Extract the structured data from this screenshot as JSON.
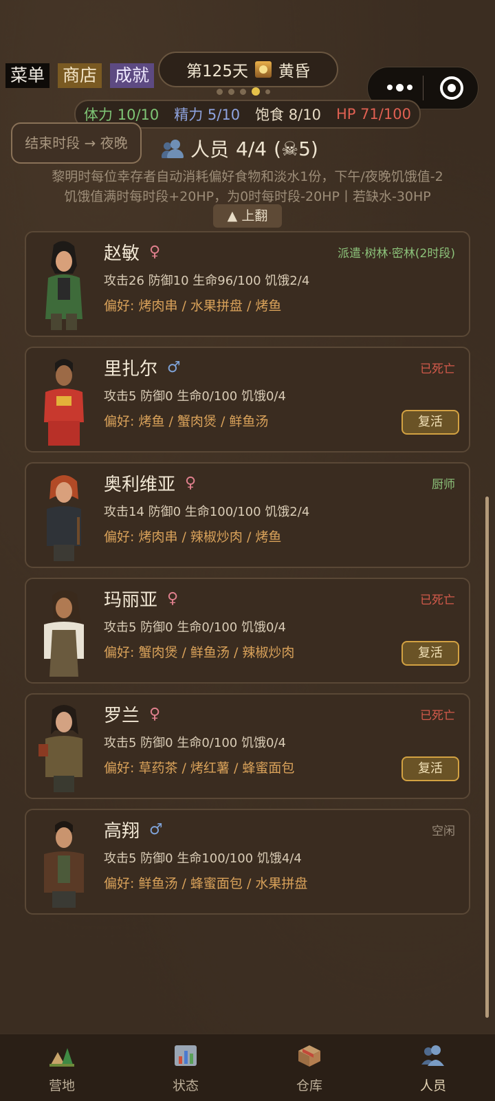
{
  "top_buttons": {
    "menu": "菜单",
    "shop": "商店",
    "achievements": "成就"
  },
  "day": {
    "label": "第125天",
    "period": "黄昏"
  },
  "pager": {
    "count": 5,
    "active_index": 3
  },
  "stats": {
    "stamina": "体力 10/10",
    "energy": "精力 5/10",
    "satiety": "饱食 8/10",
    "hp": "HP 71/100"
  },
  "end_button": "结束时段 → 夜晚",
  "people": {
    "title": "人员",
    "count": "4/4",
    "dead": "(☠5)"
  },
  "info_lines": [
    "黎明时每位幸存者自动消耗偏好食物和淡水1份，下午/夜晚饥饿值-2",
    "饥饿值满时每时段+20HP，为0时每时段-20HP丨若缺水-30HP"
  ],
  "page_up": "▲ 上翻",
  "survivors": [
    {
      "name": "赵敏",
      "sex": "♀",
      "stats": "攻击26  防御10  生命96/100  饥饿2/4",
      "pref": "偏好: 烤肉串 / 水果拼盘 / 烤鱼",
      "status": "派遣·树林·密林(2时段)",
      "status_color": "#8cc27a"
    },
    {
      "name": "里扎尔",
      "sex": "♂",
      "stats": "攻击5  防御0  生命0/100  饥饿0/4",
      "pref": "偏好: 烤鱼 / 蟹肉煲 / 鲜鱼汤",
      "status": "已死亡",
      "status_color": "#d45a4b",
      "revive": "复活"
    },
    {
      "name": "奥利维亚",
      "sex": "♀",
      "stats": "攻击14  防御0  生命100/100  饥饿2/4",
      "pref": "偏好: 烤肉串 / 辣椒炒肉 / 烤鱼",
      "status": "厨师",
      "status_color": "#8cc27a"
    },
    {
      "name": "玛丽亚",
      "sex": "♀",
      "stats": "攻击5  防御0  生命0/100  饥饿0/4",
      "pref": "偏好: 蟹肉煲 / 鲜鱼汤 / 辣椒炒肉",
      "status": "已死亡",
      "status_color": "#d45a4b",
      "revive": "复活"
    },
    {
      "name": "罗兰",
      "sex": "♀",
      "stats": "攻击5  防御0  生命0/100  饥饿0/4",
      "pref": "偏好: 草药茶 / 烤红薯 / 蜂蜜面包",
      "status": "已死亡",
      "status_color": "#d45a4b",
      "revive": "复活"
    },
    {
      "name": "高翔",
      "sex": "♂",
      "stats": "攻击5  防御0  生命100/100  饥饿4/4",
      "pref": "偏好: 鲜鱼汤 / 蜂蜜面包 / 水果拼盘",
      "status": "空闲",
      "status_color": "#9b8d7c"
    }
  ],
  "nav": [
    {
      "label": "营地",
      "icon": "camp-icon"
    },
    {
      "label": "状态",
      "icon": "chart-icon"
    },
    {
      "label": "仓库",
      "icon": "box-icon"
    },
    {
      "label": "人员",
      "icon": "people-icon",
      "active": true
    }
  ]
}
